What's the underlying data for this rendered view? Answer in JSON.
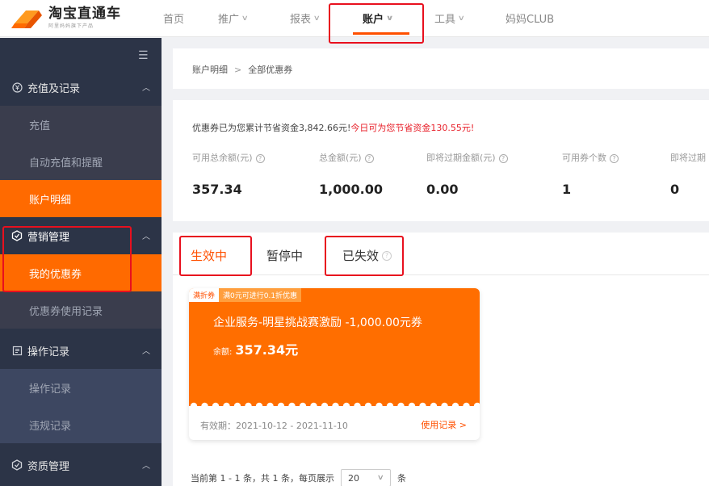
{
  "brand": {
    "title": "淘宝直通车",
    "subtitle": "阿里妈妈旗下产品"
  },
  "nav": {
    "items": [
      {
        "label": "首页",
        "chevron": false
      },
      {
        "label": "推广",
        "chevron": true
      },
      {
        "label": "报表",
        "chevron": true
      },
      {
        "label": "账户",
        "chevron": true,
        "active": true
      },
      {
        "label": "工具",
        "chevron": true
      },
      {
        "label": "妈妈CLUB",
        "chevron": false
      }
    ],
    "chevron_glyph": "∨"
  },
  "sidebar": {
    "groups": [
      {
        "label": "充值及记录",
        "icon": "yen-icon"
      },
      {
        "label": "营销管理",
        "icon": "marketing-icon"
      },
      {
        "label": "操作记录",
        "icon": "record-icon"
      },
      {
        "label": "资质管理",
        "icon": "qualification-icon"
      }
    ],
    "items": [
      {
        "label": "充值"
      },
      {
        "label": "自动充值和提醒"
      },
      {
        "label": "账户明细",
        "active": true
      },
      {
        "label": "我的优惠券",
        "active": true
      },
      {
        "label": "优惠券使用记录"
      },
      {
        "label": "操作记录"
      },
      {
        "label": "违规记录"
      }
    ]
  },
  "breadcrumb": {
    "parent": "账户明细",
    "sep": ">",
    "current": "全部优惠券"
  },
  "summary": {
    "savings_prefix": "优惠券已为您累计节省资金3,842.66元!",
    "savings_today": "今日可为您节省资金130.55元!",
    "stats": [
      {
        "label": "可用总余额(元)",
        "value": "357.34"
      },
      {
        "label": "总金额(元)",
        "value": "1,000.00"
      },
      {
        "label": "即将过期金额(元)",
        "value": "0.00"
      },
      {
        "label": "可用券个数",
        "value": "1"
      },
      {
        "label": "即将过期",
        "value": "0"
      }
    ],
    "help_glyph": "?"
  },
  "tabs": [
    {
      "label": "生效中",
      "active": true
    },
    {
      "label": "暂停中"
    },
    {
      "label": "已失效",
      "help": true
    }
  ],
  "coupon": {
    "tag_type": "满折券",
    "tag_rule": "满0元可进行0.1折优惠",
    "title": "企业服务-明星挑战赛激励 -1,000.00元券",
    "balance_label": "余额:",
    "balance_value": "357.34元",
    "validity": "有效期：2021-10-12 - 2021-11-10",
    "use_record": "使用记录 >"
  },
  "pager": {
    "prefix": "当前第 1 - 1 条，共 1 条，每页展示",
    "page_size": "20",
    "suffix": "条"
  },
  "colors": {
    "accent": "#ff5000",
    "coupon": "#ff6e00",
    "sidebar": "#2c3447",
    "highlight": "#e8101e"
  }
}
